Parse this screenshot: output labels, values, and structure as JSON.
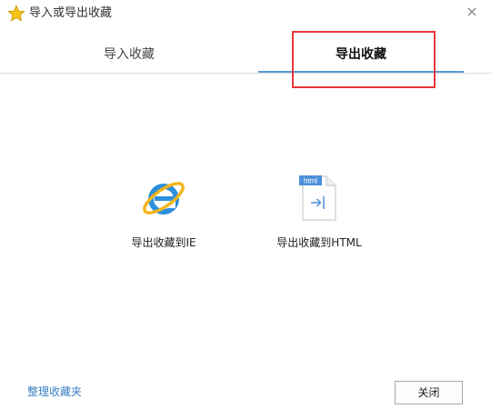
{
  "window": {
    "title": "导入或导出收藏",
    "app_icon": "star-icon",
    "close_icon": "close-icon"
  },
  "tabs": [
    {
      "label": "导入收藏",
      "active": false
    },
    {
      "label": "导出收藏",
      "active": true
    }
  ],
  "export_options": [
    {
      "label": "导出收藏到IE",
      "icon": "ie-icon"
    },
    {
      "label": "导出收藏到HTML",
      "icon": "html-file-icon",
      "badge": "html"
    }
  ],
  "footer": {
    "organize_link": "整理收藏夹",
    "close_button": "关闭"
  },
  "colors": {
    "accent": "#5b9bd5",
    "link": "#3a7fc1",
    "highlight": "#e8373e"
  }
}
